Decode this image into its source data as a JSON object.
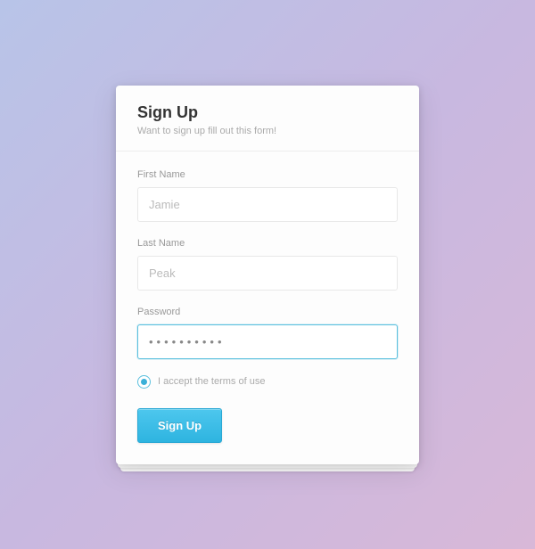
{
  "header": {
    "title": "Sign Up",
    "subtitle": "Want to sign up fill out this form!"
  },
  "fields": {
    "first_name": {
      "label": "First Name",
      "value": "Jamie"
    },
    "last_name": {
      "label": "Last Name",
      "value": "Peak"
    },
    "password": {
      "label": "Password",
      "display": "••••••••••"
    }
  },
  "terms": {
    "label": "I accept the terms of use",
    "checked": true
  },
  "submit": {
    "label": "Sign Up"
  }
}
